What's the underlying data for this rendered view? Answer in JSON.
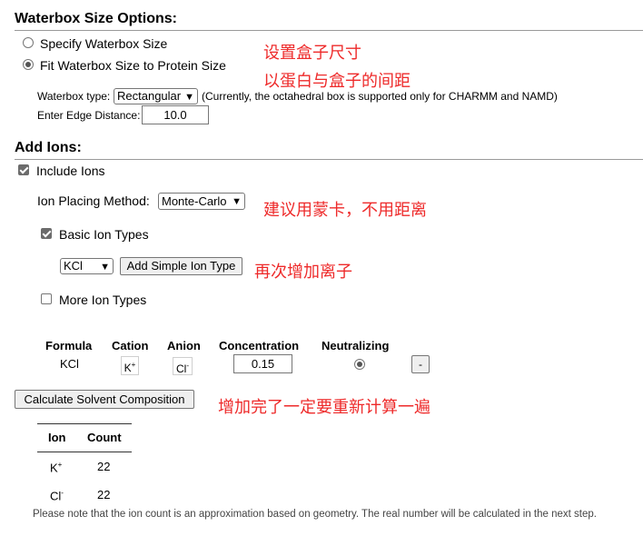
{
  "waterbox": {
    "title": "Waterbox Size Options:",
    "opt_specify": "Specify Waterbox Size",
    "opt_fit": "Fit Waterbox Size to Protein Size",
    "type_label": "Waterbox type:",
    "type_value": "Rectangular",
    "type_note": "(Currently, the octahedral box is supported only for CHARMM and NAMD)",
    "edge_label": "Enter Edge Distance:",
    "edge_value": "10.0"
  },
  "ions": {
    "title": "Add Ions:",
    "include_label": "Include Ions",
    "method_label": "Ion Placing Method:",
    "method_value": "Monte-Carlo",
    "basic_label": "Basic Ion Types",
    "ion_type_value": "KCl",
    "add_button": "Add Simple Ion Type",
    "more_label": "More Ion Types",
    "table_headers": [
      "Formula",
      "Cation",
      "Anion",
      "Concentration",
      "Neutralizing"
    ],
    "row": {
      "formula": "KCl",
      "cation": "K",
      "cation_sup": "+",
      "anion": "Cl",
      "anion_sup": "-",
      "concentration": "0.15",
      "remove": "-"
    }
  },
  "calc": {
    "button": "Calculate Solvent Composition",
    "headers": [
      "Ion",
      "Count"
    ],
    "rows": [
      {
        "ion": "K",
        "sup": "+",
        "count": "22"
      },
      {
        "ion": "Cl",
        "sup": "-",
        "count": "22"
      }
    ],
    "note": "Please note that the ion count is an approximation based on geometry. The real number will be calculated in the next step."
  },
  "annotations": {
    "a1": "设置盒子尺寸",
    "a2": "以蛋白与盒子的间距",
    "a3": "建议用蒙卡，不用距离",
    "a4": "再次增加离子",
    "a5": "增加完了一定要重新计算一遍"
  },
  "colors": {
    "annotation": "#ee2a2a"
  }
}
